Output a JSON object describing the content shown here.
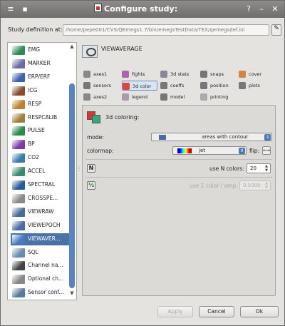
{
  "window": {
    "title": "Configure study:",
    "help": "?",
    "minimize": "–",
    "close": "✕",
    "menu": "≡",
    "pin": "■"
  },
  "study": {
    "label": "Study definition at:",
    "path": "/home/pepe001/CVS/QEmegs1.7/bin/emegsTestData/TEX/qemegsdef.ini"
  },
  "sidebar": {
    "items": [
      {
        "label": "EMG",
        "color": "#2e8b57"
      },
      {
        "label": "MARKER",
        "color": "#6a6aa8"
      },
      {
        "label": "ERP/ERF",
        "color": "#4060b0"
      },
      {
        "label": "ICG",
        "color": "#8a4a2a"
      },
      {
        "label": "RESP",
        "color": "#c08030"
      },
      {
        "label": "RESPCALIB",
        "color": "#a08040"
      },
      {
        "label": "PULSE",
        "color": "#2a8a4a"
      },
      {
        "label": "BP",
        "color": "#7a3aa8"
      },
      {
        "label": "CO2",
        "color": "#3a7ab0"
      },
      {
        "label": "ACCEL",
        "color": "#3a8a6a"
      },
      {
        "label": "SPECTRAL",
        "color": "#2a5a9a"
      },
      {
        "label": "CROSSPE...",
        "color": "#8a8a8a"
      },
      {
        "label": "VIEWRAW",
        "color": "#4a6a9a"
      },
      {
        "label": "VIEWEPOCH",
        "color": "#4a6aaa"
      },
      {
        "label": "VIEWAVER...",
        "color": "#4a7ac0"
      },
      {
        "label": "SQL",
        "color": "#6a8ab0"
      },
      {
        "label": "Channel na...",
        "color": "#444444"
      },
      {
        "label": "Optional ch...",
        "color": "#888888"
      },
      {
        "label": "Sensor conf...",
        "color": "#5a7a9a"
      }
    ],
    "selected_index": 14
  },
  "panel_title": "VIEWAVERAGE",
  "tabs": [
    {
      "label": "axes1",
      "icon": "axes-icon"
    },
    {
      "label": "fights",
      "icon": "fights-icon"
    },
    {
      "label": "3d stats",
      "icon": "stats-icon"
    },
    {
      "label": "snaps",
      "icon": "snaps-icon"
    },
    {
      "label": "cover",
      "icon": "cover-icon"
    },
    {
      "label": "sensors",
      "icon": "sensors-icon"
    },
    {
      "label": "3d color",
      "icon": "color-icon"
    },
    {
      "label": "coeffs",
      "icon": "coeffs-icon"
    },
    {
      "label": "position",
      "icon": "position-icon"
    },
    {
      "label": "plots",
      "icon": "plots-icon"
    },
    {
      "label": "axes2",
      "icon": "axes2-icon"
    },
    {
      "label": "legend",
      "icon": "legend-icon"
    },
    {
      "label": "model",
      "icon": "model-icon"
    },
    {
      "label": "printing",
      "icon": "printing-icon"
    }
  ],
  "selected_tab": "3d color",
  "coloring": {
    "title": "3d coloring:",
    "mode_label": "mode:",
    "mode_value": "areas with contour",
    "colormap_label": "colormap:",
    "colormap_value": "jet",
    "flip_label": "flip:",
    "flip_icon": "⟷",
    "n_toggle": "N",
    "use_n_label": "use N colors:",
    "n_colors": "20",
    "amp_toggle": "½",
    "amp_label": "use 1 color / amp:",
    "amp_value": "0.5000"
  },
  "buttons": {
    "apply": "Apply",
    "cancel": "Cancel",
    "ok": "Ok"
  }
}
